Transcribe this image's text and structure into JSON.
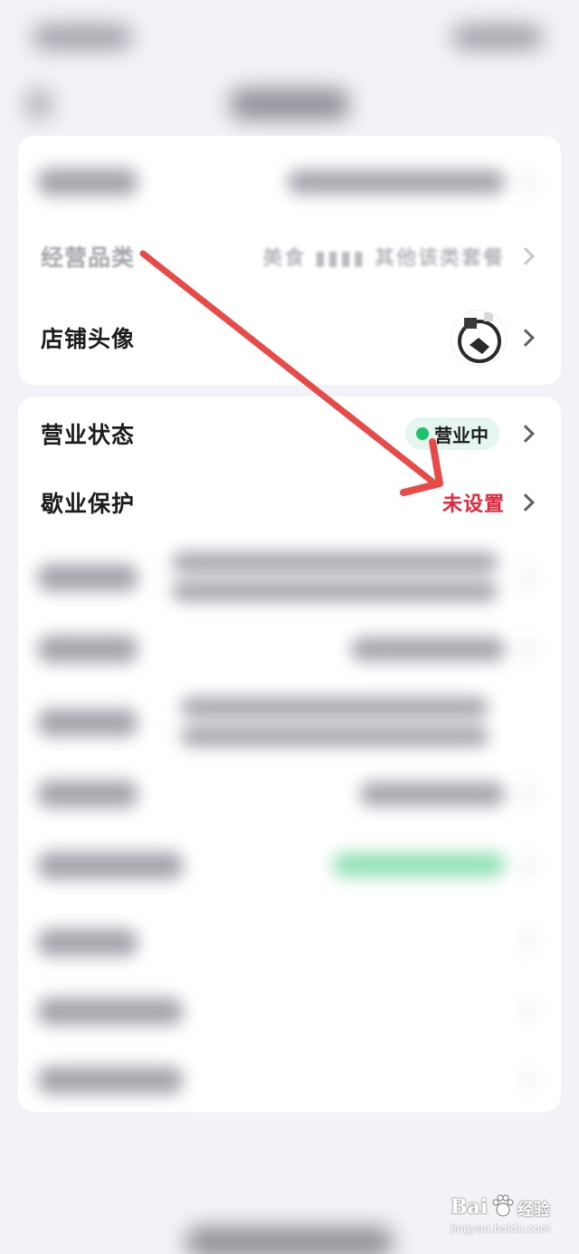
{
  "shop_info": {
    "category_label": "经营品类",
    "category_value": "美食 ▮▮▮▮ 其他该类套餐",
    "avatar_label": "店铺头像"
  },
  "operation": {
    "status_label": "营业状态",
    "status_value": "营业中",
    "protection_label": "歇业保护",
    "protection_value": "未设置"
  },
  "annotation": {
    "arrow_color": "#e84a47"
  },
  "colors": {
    "open_green": "#1fc06b",
    "unset_red": "#e5263d"
  },
  "watermark": {
    "brand": "Bai",
    "brand2": "经验",
    "url": "jingyan.baidu.com"
  }
}
